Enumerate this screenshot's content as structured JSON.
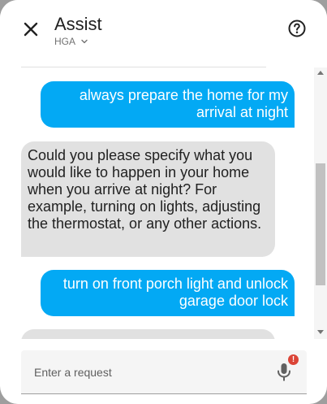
{
  "dialog": {
    "title": "Assist",
    "pipeline": "HGA"
  },
  "messages": [
    {
      "from": "user",
      "text": "always prepare the home for my arrival at night"
    },
    {
      "from": "hass",
      "text": "Could you please specify what you would like to happen in your home when you arrive at night? For example, turning on lights, adjusting the thermostat, or any other actions."
    },
    {
      "from": "user",
      "text": "turn on front porch light and unlock garage door lock"
    },
    {
      "from": "hass",
      "text": ""
    }
  ],
  "input": {
    "placeholder": "Enter a request",
    "value": ""
  },
  "mic": {
    "badge": "!"
  },
  "icons": {
    "close": "close-icon",
    "pipeline_menu": "chevron-down-icon",
    "help": "help-circle-icon",
    "mic": "microphone-icon"
  },
  "colors": {
    "user_bubble": "#03a9f4",
    "assistant_bubble": "#e1e1e1",
    "badge": "#db4437"
  }
}
